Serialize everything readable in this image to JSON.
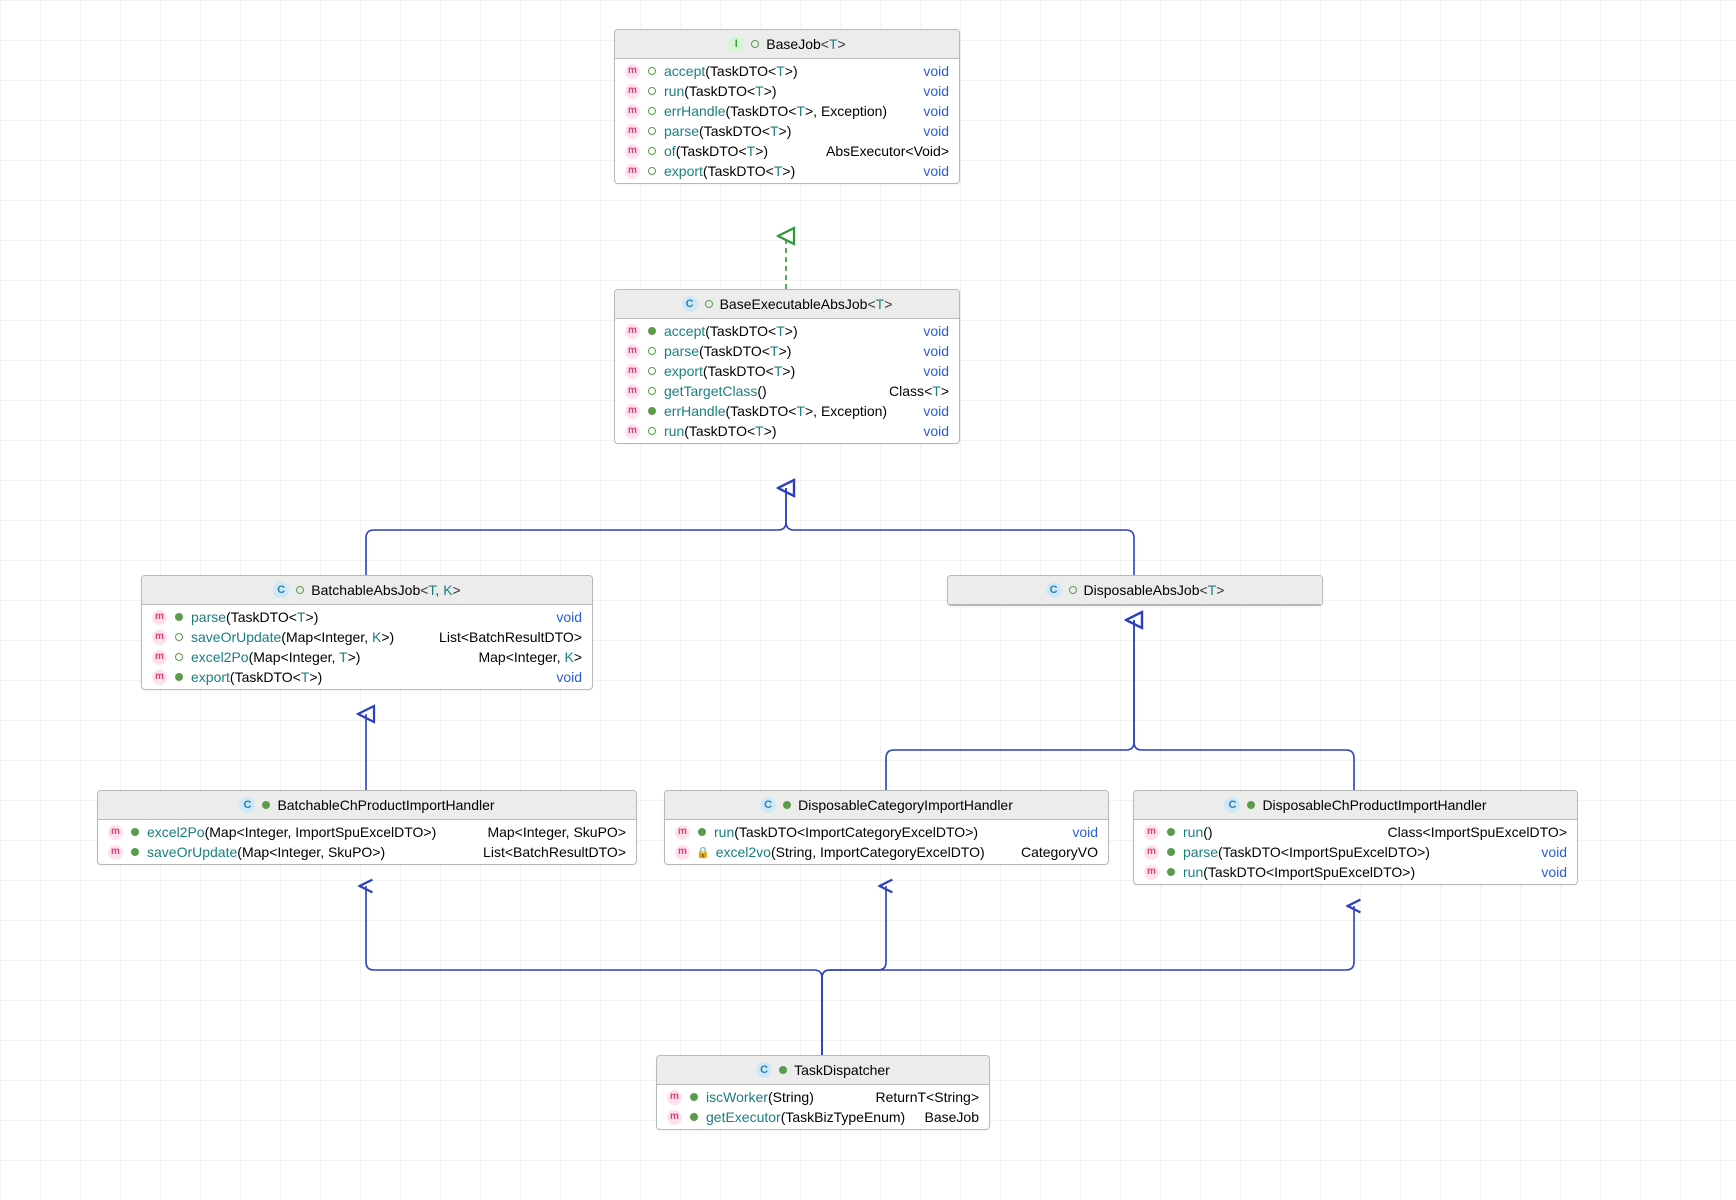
{
  "diagram": {
    "baseJob": {
      "kind": "I",
      "name": "BaseJob",
      "generic": "<T>",
      "methods": [
        {
          "vis": "abs",
          "name": "accept",
          "params": "(TaskDTO<T>)",
          "ret": "void",
          "retClass": "v"
        },
        {
          "vis": "abs",
          "name": "run",
          "params": "(TaskDTO<T>)",
          "ret": "void",
          "retClass": "v"
        },
        {
          "vis": "abs",
          "name": "errHandle",
          "params": "(TaskDTO<T>, Exception)",
          "ret": "void",
          "retClass": "v"
        },
        {
          "vis": "abs",
          "name": "parse",
          "params": "(TaskDTO<T>)",
          "ret": "void",
          "retClass": "v"
        },
        {
          "vis": "abs",
          "name": "of",
          "params": "(TaskDTO<T>)",
          "ret": "AbsExecutor<Void>",
          "retClass": ""
        },
        {
          "vis": "abs",
          "name": "export",
          "params": "(TaskDTO<T>)",
          "ret": "void",
          "retClass": "v"
        }
      ]
    },
    "baseExec": {
      "kind": "C",
      "name": "BaseExecutableAbsJob",
      "generic": "<T>",
      "methods": [
        {
          "vis": "pub",
          "name": "accept",
          "params": "(TaskDTO<T>)",
          "ret": "void",
          "retClass": "v"
        },
        {
          "vis": "abs",
          "name": "parse",
          "params": "(TaskDTO<T>)",
          "ret": "void",
          "retClass": "v"
        },
        {
          "vis": "abs",
          "name": "export",
          "params": "(TaskDTO<T>)",
          "ret": "void",
          "retClass": "v"
        },
        {
          "vis": "abs",
          "name": "getTargetClass",
          "params": "()",
          "ret": "Class<T>",
          "retClass": ""
        },
        {
          "vis": "pub",
          "name": "errHandle",
          "params": "(TaskDTO<T>, Exception)",
          "ret": "void",
          "retClass": "v"
        },
        {
          "vis": "abs",
          "name": "run",
          "params": "(TaskDTO<T>)",
          "ret": "void",
          "retClass": "v"
        }
      ]
    },
    "batchable": {
      "kind": "C",
      "name": "BatchableAbsJob",
      "generic": "<T, K>",
      "methods": [
        {
          "vis": "pub",
          "name": "parse",
          "params": "(TaskDTO<T>)",
          "ret": "void",
          "retClass": "v"
        },
        {
          "vis": "abs",
          "name": "saveOrUpdate",
          "params": "(Map<Integer, K>)",
          "ret": "List<BatchResultDTO>",
          "retClass": ""
        },
        {
          "vis": "abs",
          "name": "excel2Po",
          "params": "(Map<Integer, T>)",
          "ret": "Map<Integer, K>",
          "retClass": ""
        },
        {
          "vis": "pub",
          "name": "export",
          "params": "(TaskDTO<T>)",
          "ret": "void",
          "retClass": "v"
        }
      ]
    },
    "disposable": {
      "kind": "C",
      "name": "DisposableAbsJob",
      "generic": "<T>",
      "methods": []
    },
    "batchableCh": {
      "kind": "C",
      "name": "BatchableChProductImportHandler",
      "generic": "",
      "methods": [
        {
          "vis": "pub",
          "name": "excel2Po",
          "params": "(Map<Integer, ImportSpuExcelDTO>)",
          "ret": "Map<Integer, SkuPO>",
          "retClass": ""
        },
        {
          "vis": "pub",
          "name": "saveOrUpdate",
          "params": "(Map<Integer, SkuPO>)",
          "ret": "List<BatchResultDTO>",
          "retClass": ""
        }
      ]
    },
    "dispCat": {
      "kind": "C",
      "name": "DisposableCategoryImportHandler",
      "generic": "",
      "methods": [
        {
          "vis": "pub",
          "name": "run",
          "params": "(TaskDTO<ImportCategoryExcelDTO>)",
          "ret": "void",
          "retClass": "v"
        },
        {
          "vis": "priv",
          "name": "excel2vo",
          "params": "(String, ImportCategoryExcelDTO)",
          "ret": "CategoryVO",
          "retClass": ""
        }
      ]
    },
    "dispCh": {
      "kind": "C",
      "name": "DisposableChProductImportHandler",
      "generic": "",
      "methods": [
        {
          "vis": "pub",
          "name": "run",
          "params": "()",
          "ret": "Class<ImportSpuExcelDTO>",
          "retClass": ""
        },
        {
          "vis": "pub",
          "name": "parse",
          "params": "(TaskDTO<ImportSpuExcelDTO>)",
          "ret": "void",
          "retClass": "v"
        },
        {
          "vis": "pub",
          "name": "run",
          "params": "(TaskDTO<ImportSpuExcelDTO>)",
          "ret": "void",
          "retClass": "v"
        }
      ]
    },
    "taskDisp": {
      "kind": "C",
      "name": "TaskDispatcher",
      "generic": "",
      "methods": [
        {
          "vis": "pub",
          "name": "iscWorker",
          "params": "(String)",
          "ret": "ReturnT<String>",
          "retClass": ""
        },
        {
          "vis": "pub",
          "name": "getExecutor",
          "params": "(TaskBizTypeEnum)",
          "ret": "BaseJob",
          "retClass": ""
        }
      ]
    }
  }
}
